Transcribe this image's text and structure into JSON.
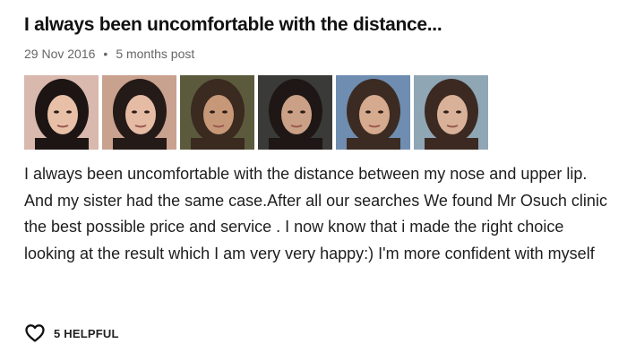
{
  "review": {
    "title": "I always been uncomfortable with the distance...",
    "date": "29 Nov 2016",
    "separator": "•",
    "post_age": "5 months post",
    "body": "I always been uncomfortable with the distance between my nose and upper lip. And my sister had the same case.After all our searches We found Mr Osuch clinic the best possible price and service . I now know that i made the right choice looking at the result which I am very very happy:) I'm more confident with myself",
    "helpful_label": "5 HELPFUL",
    "helpful_icon": "heart-outline-icon"
  },
  "photos": [
    {
      "bg": "#d9b8ad",
      "skin": "#e8c0a8",
      "hair": "#1c1514"
    },
    {
      "bg": "#c9a18f",
      "skin": "#e5bba3",
      "hair": "#241a18"
    },
    {
      "bg": "#5c5a3c",
      "skin": "#c79878",
      "hair": "#3a2a20"
    },
    {
      "bg": "#3a3a38",
      "skin": "#caa086",
      "hair": "#1e1715"
    },
    {
      "bg": "#6f8db0",
      "skin": "#d6aa8e",
      "hair": "#3b2b22"
    },
    {
      "bg": "#8fa6b5",
      "skin": "#d9b199",
      "hair": "#3c2a22"
    }
  ]
}
